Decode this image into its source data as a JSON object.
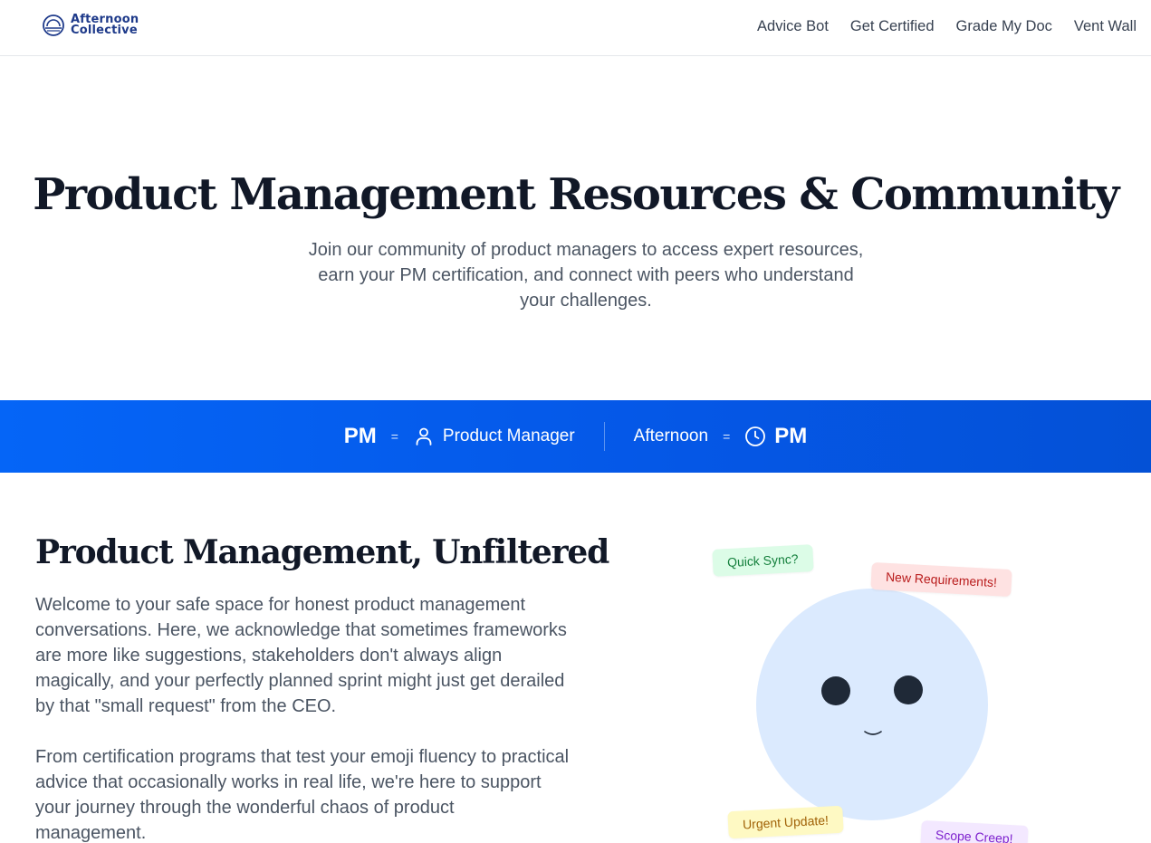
{
  "brand": {
    "logo_line1": "Afternoon",
    "logo_line2": "Collective",
    "icon": "sunset-logo-icon",
    "color": "#1e3a8a"
  },
  "nav": {
    "items": [
      {
        "label": "Advice Bot"
      },
      {
        "label": "Get Certified"
      },
      {
        "label": "Grade My Doc"
      },
      {
        "label": "Vent Wall"
      }
    ]
  },
  "hero": {
    "title": "Product Management Resources & Community",
    "subtitle_line1": "Join our community of product managers to access expert resources,",
    "subtitle_line2": "earn your PM certification, and connect with peers who understand",
    "subtitle_line3": "your challenges."
  },
  "banner": {
    "background": "#0565f7",
    "left": {
      "term": "PM",
      "equals": "=",
      "icon": "user-icon",
      "meaning": "Product Manager"
    },
    "right": {
      "term": "Afternoon",
      "equals": "=",
      "icon": "clock-icon",
      "meaning": "PM"
    }
  },
  "section": {
    "title": "Product Management, Unfiltered",
    "paragraph1": "Welcome to your safe space for honest product management conversations. Here, we acknowledge that sometimes frameworks are more like suggestions, stakeholders don't always align magically, and your perfectly planned sprint might just get derailed by that \"small request\" from the CEO.",
    "paragraph2": "From certification programs that test your emoji fluency to practical advice that occasionally works in real life, we're here to support your journey through the wonderful chaos of product management."
  },
  "illustration": {
    "tags": [
      {
        "label": "Quick Sync?",
        "color": "#15803d"
      },
      {
        "label": "New Requirements!",
        "color": "#b91c1c"
      },
      {
        "label": "Urgent Update!",
        "color": "#a16207"
      },
      {
        "label": "Scope Creep!",
        "color": "#7e22ce"
      }
    ],
    "face_color": "#dbeafe"
  }
}
